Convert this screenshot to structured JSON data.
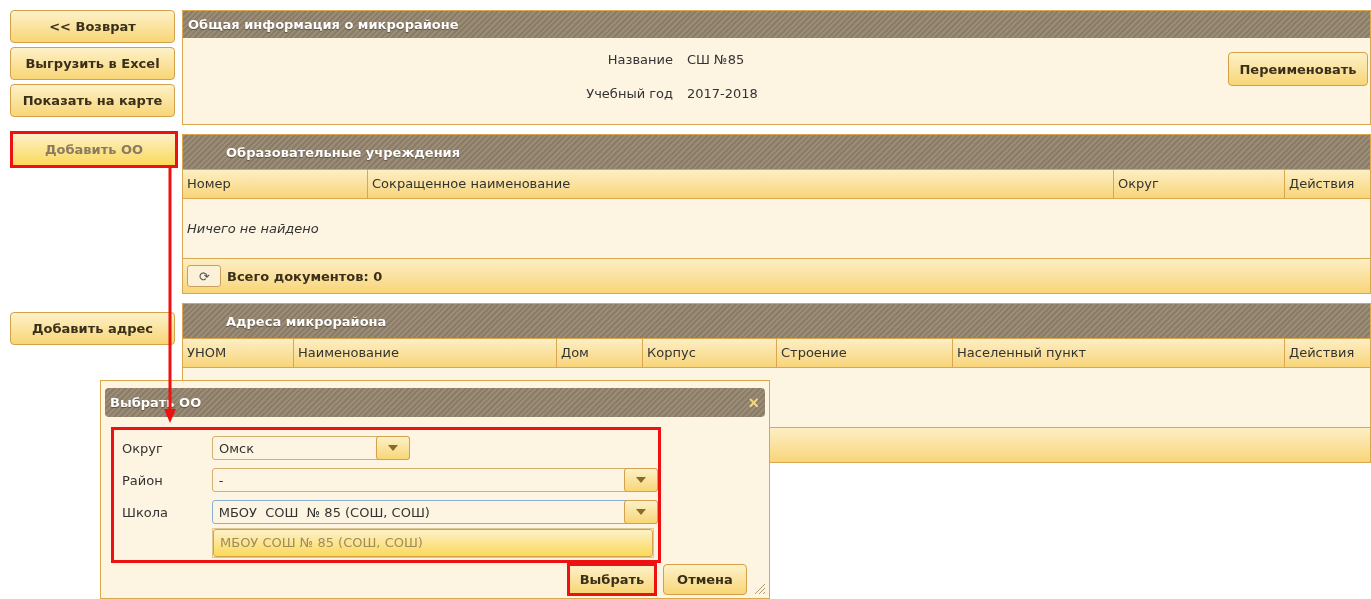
{
  "side_buttons": [
    {
      "label": "<< Возврат",
      "highlighted": false
    },
    {
      "label": "Выгрузить в Excel",
      "highlighted": false
    },
    {
      "label": "Показать на карте",
      "highlighted": false
    },
    {
      "label": "Добавить ОО",
      "highlighted": true
    },
    {
      "label": "Добавить адрес",
      "highlighted": false
    }
  ],
  "info_panel": {
    "title": "Общая информация о микрорайоне",
    "fields": [
      {
        "label": "Название",
        "value": "СШ №85"
      },
      {
        "label": "Учебный год",
        "value": "2017-2018"
      }
    ],
    "rename_button": "Переименовать"
  },
  "institutions": {
    "title": "Образовательные учреждения",
    "columns": [
      "Номер",
      "Сокращенное наименование",
      "Округ",
      "Действия"
    ],
    "empty_text": "Ничего не найдено",
    "refresh_icon": "⟳",
    "total": "Всего документов: 0"
  },
  "addresses": {
    "title": "Адреса микрорайона",
    "columns": [
      "УНОМ",
      "Наименование",
      "Дом",
      "Корпус",
      "Строение",
      "Населенный пункт",
      "Действия"
    ]
  },
  "dialog": {
    "title": "Выбрать ОО",
    "close": "×",
    "form_highlighted": true,
    "fields": [
      {
        "label": "Округ",
        "value": "Омск",
        "focused": false,
        "wide": false
      },
      {
        "label": "Район",
        "value": "-",
        "focused": false,
        "wide": true
      },
      {
        "label": "Школа",
        "value": "МБОУ  СОШ  № 85 (СОШ, СОШ)",
        "focused": true,
        "wide": true
      }
    ],
    "options": [
      {
        "label": "МБОУ СОШ № 85 (СОШ, СОШ)",
        "selected": true
      }
    ],
    "buttons": [
      {
        "label": "Выбрать",
        "highlighted": true
      },
      {
        "label": "Отмена",
        "highlighted": false
      }
    ]
  }
}
